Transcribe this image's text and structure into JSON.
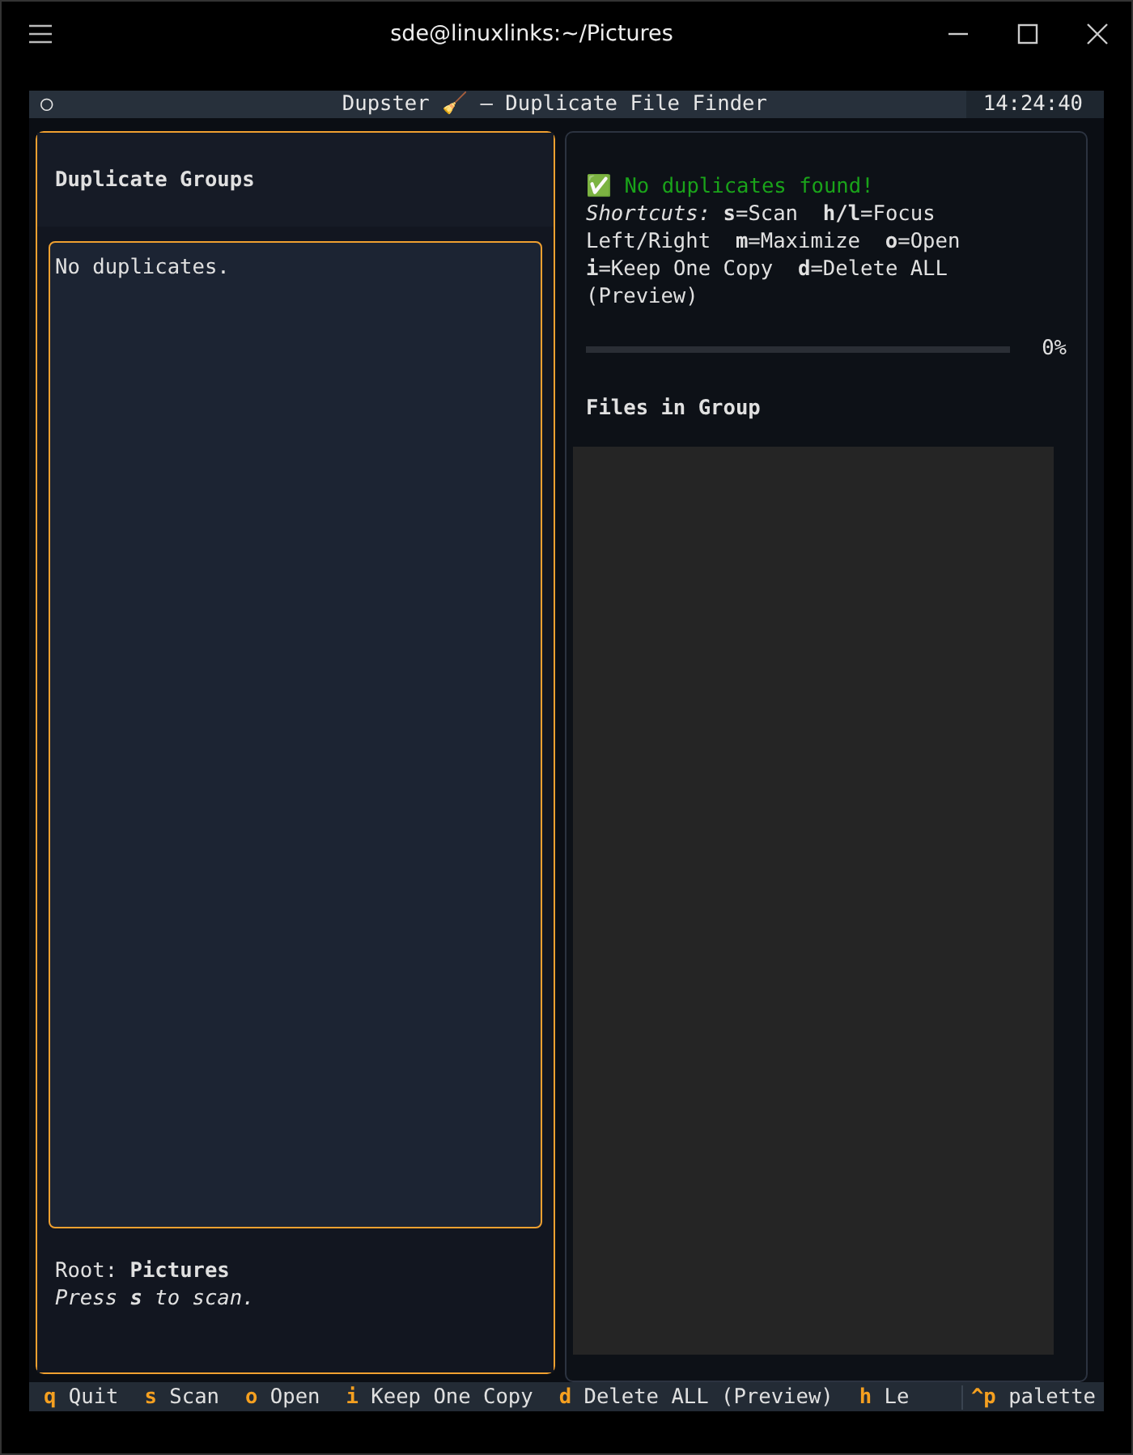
{
  "window": {
    "title": "sde@linuxlinks:~/Pictures"
  },
  "header": {
    "indicator": "○",
    "title": "Dupster 🧹 — Duplicate File Finder",
    "clock": "14:24:40"
  },
  "groups_panel": {
    "title": "Duplicate Groups",
    "focused": true,
    "list_text": "No duplicates.",
    "root_label": "Root:",
    "root_value": "Pictures",
    "hint": "Press **s** to scan."
  },
  "details_panel": {
    "focused": false,
    "status": "✅ No duplicates found!",
    "shortcuts": "*Shortcuts:* **s**=Scan  **h/l**=Focus Left/Right  **m**=Maximize  **o**=Open  **i**=Keep One Copy  **d**=Delete ALL (Preview)",
    "progress": {
      "reading": "0%"
    },
    "files_title": "Files in Group"
  },
  "footer": {
    "bindings": [
      {
        "key": "q",
        "label": "Quit"
      },
      {
        "key": "s",
        "label": "Scan"
      },
      {
        "key": "o",
        "label": "Open"
      },
      {
        "key": "i",
        "label": "Keep One Copy"
      },
      {
        "key": "d",
        "label": "Delete ALL (Preview)"
      },
      {
        "key": "h",
        "label": "Le"
      }
    ],
    "palette": {
      "key": "^p",
      "label": "palette"
    }
  }
}
